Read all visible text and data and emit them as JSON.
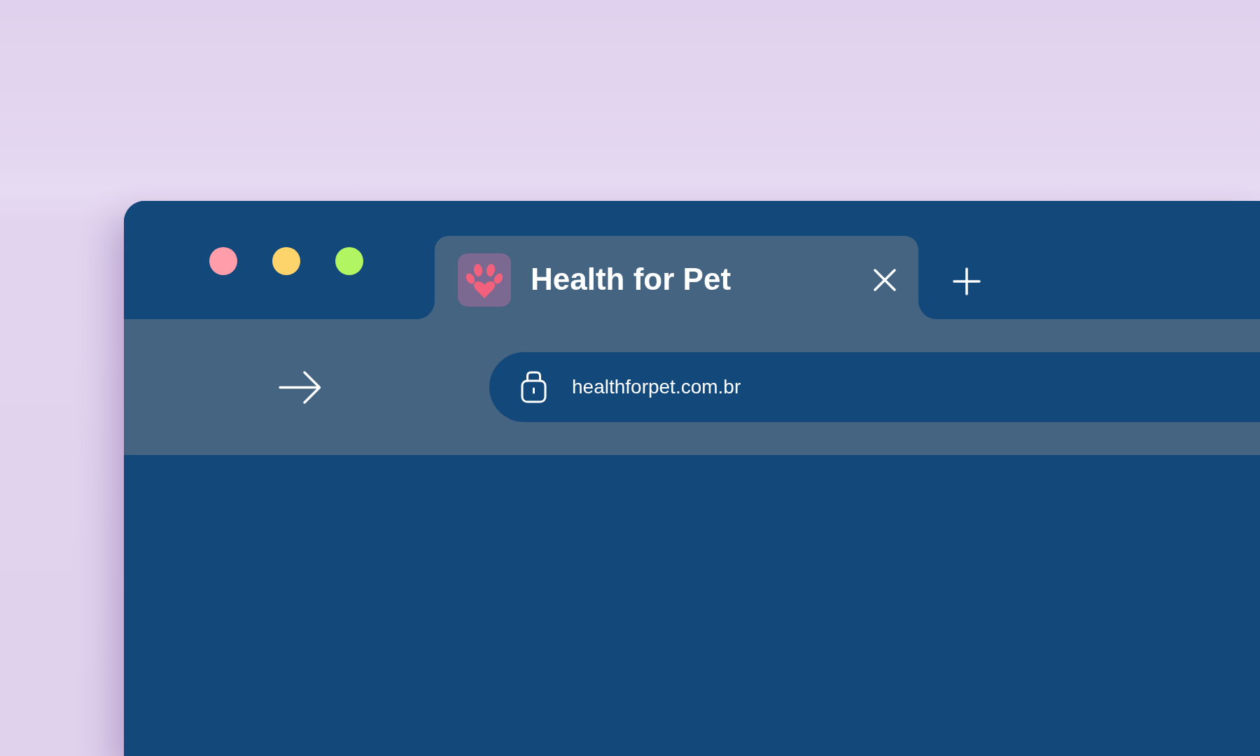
{
  "window_controls": [
    {
      "color": "#ff9eaa"
    },
    {
      "color": "#fdd46b"
    },
    {
      "color": "#b2f562"
    }
  ],
  "tabs": [
    {
      "title": "Health for Pet",
      "selected": true
    }
  ],
  "address_bar": {
    "value": "healthforpet.com.br"
  }
}
